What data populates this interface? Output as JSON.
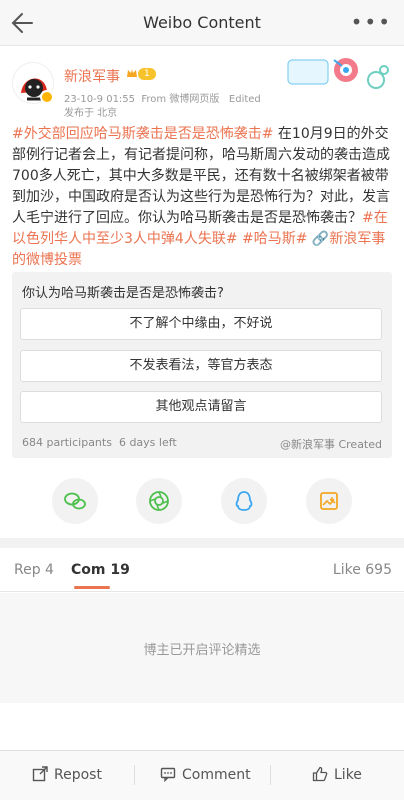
{
  "header": {
    "title": "Weibo Content",
    "more_icon": "more-dots-icon",
    "back_icon": "back-arrow-icon"
  },
  "post": {
    "user_name": "新浪军事",
    "level": "1",
    "time": "23-10-9 01:55",
    "source": "From 微博网页版",
    "edited": "Edited",
    "location": "发布于 北京",
    "content": {
      "hashtag1": "#外交部回应哈马斯袭击是否是恐怖袭击#",
      "text1": " 在10月9日的外交部例行记者会上，有记者提问称，哈马斯周六发动的袭击造成700多人死亡，其中大多数是平民，还有数十名被绑架者被带到加沙，中国政府是否认为这些行为是恐怖行为？对此，发言人毛宁进行了回应。你认为哈马斯袭击是否是恐怖袭击？",
      "hashtag2": "#在以色列华人中至少3人中弹4人失联#",
      "hashtag3": " #哈马斯#",
      "link": " 🔗新浪军事的微博投票"
    }
  },
  "poll": {
    "question": "你认为哈马斯袭击是否是恐怖袭击?",
    "options": [
      "不了解个中缘由，不好说",
      "不发表看法，等官方表态",
      "其他观点请留言"
    ],
    "participants": "684 participants",
    "time_left": "6 days left",
    "creator": "@新浪军事 Created"
  },
  "tabs": {
    "repost": "Rep 4",
    "comment": "Com 19",
    "like": "Like 695"
  },
  "comments": {
    "note": "博主已开启评论精选"
  },
  "bottom": {
    "repost": "Repost",
    "comment": "Comment",
    "like": "Like"
  },
  "colors": {
    "accent": "#eb7350",
    "wechat": "#4cbf4c",
    "moments": "#4cbf4c",
    "qq": "#3aa7f0",
    "album": "#f5a623"
  }
}
